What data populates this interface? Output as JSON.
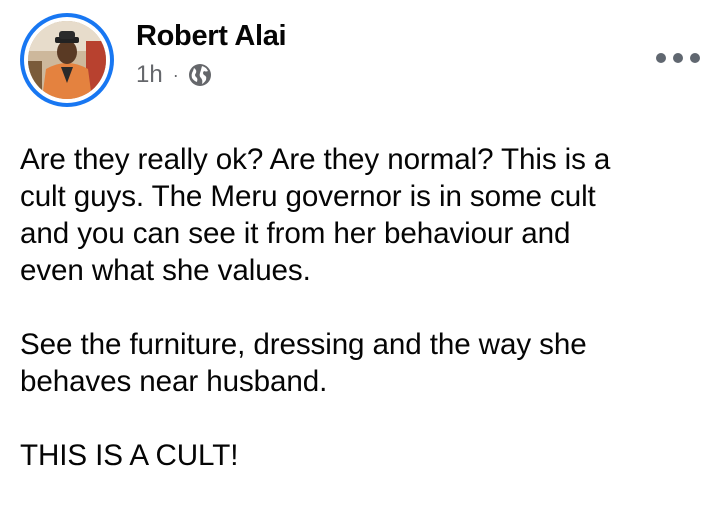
{
  "post": {
    "author": "Robert Alai",
    "time": "1h",
    "separator": "·",
    "privacy_icon": "globe-icon",
    "more_icon": "more-options-icon",
    "paragraphs": [
      "Are they really ok? Are they normal? This is a\ncult guys. The Meru governor is in some cult\nand you can see it from her behaviour and\neven what she values.",
      "See the furniture, dressing and the way she\nbehaves near husband.",
      "THIS IS A CULT!"
    ]
  },
  "colors": {
    "avatar_ring": "#1877f2",
    "meta_text": "#65676b",
    "body_text": "#050505"
  }
}
